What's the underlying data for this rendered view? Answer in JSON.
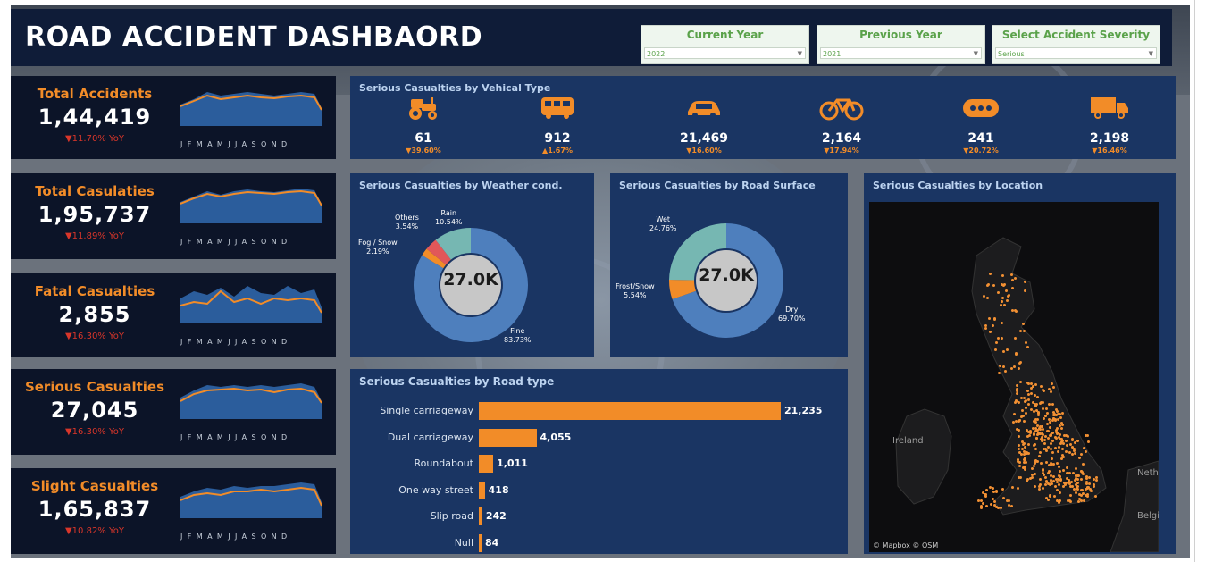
{
  "title": "ROAD ACCIDENT DASHBAORD",
  "filters": [
    {
      "label": "Current Year",
      "value": "2022"
    },
    {
      "label": "Previous Year",
      "value": "2021"
    },
    {
      "label": "Select Accident Severity",
      "value": "Serious"
    }
  ],
  "kpis": [
    {
      "label": "Total Accidents",
      "value": "1,44,419",
      "yoy": "▼11.70% YoY"
    },
    {
      "label": "Total Casulaties",
      "value": "1,95,737",
      "yoy": "▼11.89% YoY"
    },
    {
      "label": "Fatal Casualties",
      "value": "2,855",
      "yoy": "▼16.30% YoY"
    },
    {
      "label": "Serious Casualties",
      "value": "27,045",
      "yoy": "▼16.30% YoY"
    },
    {
      "label": "Slight Casualties",
      "value": "1,65,837",
      "yoy": "▼10.82% YoY"
    }
  ],
  "months_axis": "JFMAMJJASOND",
  "vehicle_panel": {
    "title": "Serious Casualties by Vehical Type",
    "items": [
      {
        "icon": "tractor-icon",
        "value": "61",
        "change": "▼39.60%"
      },
      {
        "icon": "bus-icon",
        "value": "912",
        "change": "▲1.67%"
      },
      {
        "icon": "car-icon",
        "value": "21,469",
        "change": "▼16.60%"
      },
      {
        "icon": "bicycle-icon",
        "value": "2,164",
        "change": "▼17.94%"
      },
      {
        "icon": "other-vehicle-icon",
        "value": "241",
        "change": "▼20.72%"
      },
      {
        "icon": "truck-icon",
        "value": "2,198",
        "change": "▼16.46%"
      }
    ]
  },
  "weather_panel": {
    "title": "Serious Casualties by Weather cond.",
    "center": "27.0K",
    "segments": [
      {
        "name": "Fine",
        "pct": "83.73%",
        "share": 83.73,
        "color": "#4e7fbd"
      },
      {
        "name": "Fog / Snow",
        "pct": "2.19%",
        "share": 2.19,
        "color": "#f28c28"
      },
      {
        "name": "Others",
        "pct": "3.54%",
        "share": 3.54,
        "color": "#e15759"
      },
      {
        "name": "Rain",
        "pct": "10.54%",
        "share": 10.54,
        "color": "#76b7b2"
      }
    ]
  },
  "surface_panel": {
    "title": "Serious Casualties by Road Surface",
    "center": "27.0K",
    "segments": [
      {
        "name": "Dry",
        "pct": "69.70%",
        "share": 69.7,
        "color": "#4e7fbd"
      },
      {
        "name": "Frost/Snow",
        "pct": "5.54%",
        "share": 5.54,
        "color": "#f28c28"
      },
      {
        "name": "Wet",
        "pct": "24.76%",
        "share": 24.76,
        "color": "#76b7b2"
      }
    ]
  },
  "road_panel": {
    "title": "Serious Casualties by Road type",
    "rows": [
      {
        "label": "Single carriageway",
        "value": 21235,
        "display": "21,235"
      },
      {
        "label": "Dual carriageway",
        "value": 4055,
        "display": "4,055"
      },
      {
        "label": "Roundabout",
        "value": 1011,
        "display": "1,011"
      },
      {
        "label": "One way street",
        "value": 418,
        "display": "418"
      },
      {
        "label": "Slip road",
        "value": 242,
        "display": "242"
      },
      {
        "label": "Null",
        "value": 84,
        "display": "84"
      }
    ]
  },
  "map_panel": {
    "title": "Serious Casualties by Location",
    "labels": {
      "ireland": "Ireland",
      "neth": "Neth",
      "belg": "Belgi"
    },
    "attribution": "© Mapbox © OSM"
  },
  "colors": {
    "accent": "#f28c28",
    "negative": "#d9362a",
    "panel": "#1a3563",
    "title_bar": "#0f1c38"
  }
}
